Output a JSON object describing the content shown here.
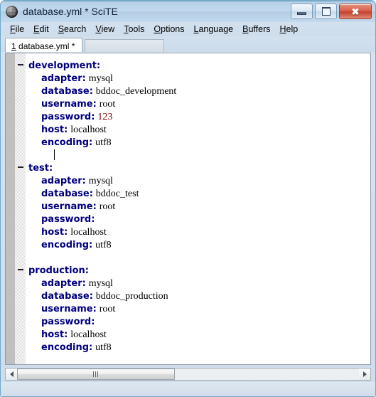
{
  "window": {
    "title": "database.yml * SciTE",
    "icon": "scite-sphere-icon",
    "minimize_label": "–",
    "maximize_label": "□",
    "close_label": "✕"
  },
  "menubar": {
    "items": [
      {
        "label": "File",
        "mnemonic": "F"
      },
      {
        "label": "Edit",
        "mnemonic": "E"
      },
      {
        "label": "Search",
        "mnemonic": "S"
      },
      {
        "label": "View",
        "mnemonic": "V"
      },
      {
        "label": "Tools",
        "mnemonic": "T"
      },
      {
        "label": "Options",
        "mnemonic": "O"
      },
      {
        "label": "Language",
        "mnemonic": "L"
      },
      {
        "label": "Buffers",
        "mnemonic": "B"
      },
      {
        "label": "Help",
        "mnemonic": "H"
      }
    ]
  },
  "tabs": {
    "active_index": 0,
    "items": [
      {
        "number": "1",
        "filename": "database.yml",
        "modified_marker": "*",
        "full_label": "1 database.yml *"
      }
    ]
  },
  "editor": {
    "colors": {
      "key": "#00007f",
      "value": "#000000",
      "number": "#7f0000",
      "background": "#ffffff",
      "selection_margin": "#c0c0c0"
    },
    "lines": [
      {
        "fold": true,
        "indent": 0,
        "key": "development:",
        "value": ""
      },
      {
        "fold": false,
        "indent": 1,
        "key": "adapter:",
        "value": "mysql"
      },
      {
        "fold": false,
        "indent": 1,
        "key": "database:",
        "value": "bddoc_development"
      },
      {
        "fold": false,
        "indent": 1,
        "key": "username:",
        "value": "root"
      },
      {
        "fold": false,
        "indent": 1,
        "key": "password:",
        "value": "123",
        "numeric": true
      },
      {
        "fold": false,
        "indent": 1,
        "key": "host:",
        "value": "localhost"
      },
      {
        "fold": false,
        "indent": 1,
        "key": "encoding:",
        "value": "utf8"
      },
      {
        "fold": false,
        "indent": 1,
        "key": "",
        "value": "",
        "caret": true
      },
      {
        "fold": true,
        "indent": 0,
        "key": "test:",
        "value": ""
      },
      {
        "fold": false,
        "indent": 1,
        "key": "adapter:",
        "value": "mysql"
      },
      {
        "fold": false,
        "indent": 1,
        "key": "database:",
        "value": "bddoc_test"
      },
      {
        "fold": false,
        "indent": 1,
        "key": "username:",
        "value": "root"
      },
      {
        "fold": false,
        "indent": 1,
        "key": "password:",
        "value": ""
      },
      {
        "fold": false,
        "indent": 1,
        "key": "host:",
        "value": "localhost"
      },
      {
        "fold": false,
        "indent": 1,
        "key": "encoding:",
        "value": "utf8"
      },
      {
        "fold": false,
        "indent": 0,
        "key": "",
        "value": ""
      },
      {
        "fold": true,
        "indent": 0,
        "key": "production:",
        "value": ""
      },
      {
        "fold": false,
        "indent": 1,
        "key": "adapter:",
        "value": "mysql"
      },
      {
        "fold": false,
        "indent": 1,
        "key": "database:",
        "value": "bddoc_production"
      },
      {
        "fold": false,
        "indent": 1,
        "key": "username:",
        "value": "root"
      },
      {
        "fold": false,
        "indent": 1,
        "key": "password:",
        "value": ""
      },
      {
        "fold": false,
        "indent": 1,
        "key": "host:",
        "value": "localhost"
      },
      {
        "fold": false,
        "indent": 1,
        "key": "encoding:",
        "value": "utf8"
      }
    ]
  },
  "scrollbar": {
    "left_arrow": "◀",
    "right_arrow": "▶",
    "thumb_grip": "|||"
  }
}
